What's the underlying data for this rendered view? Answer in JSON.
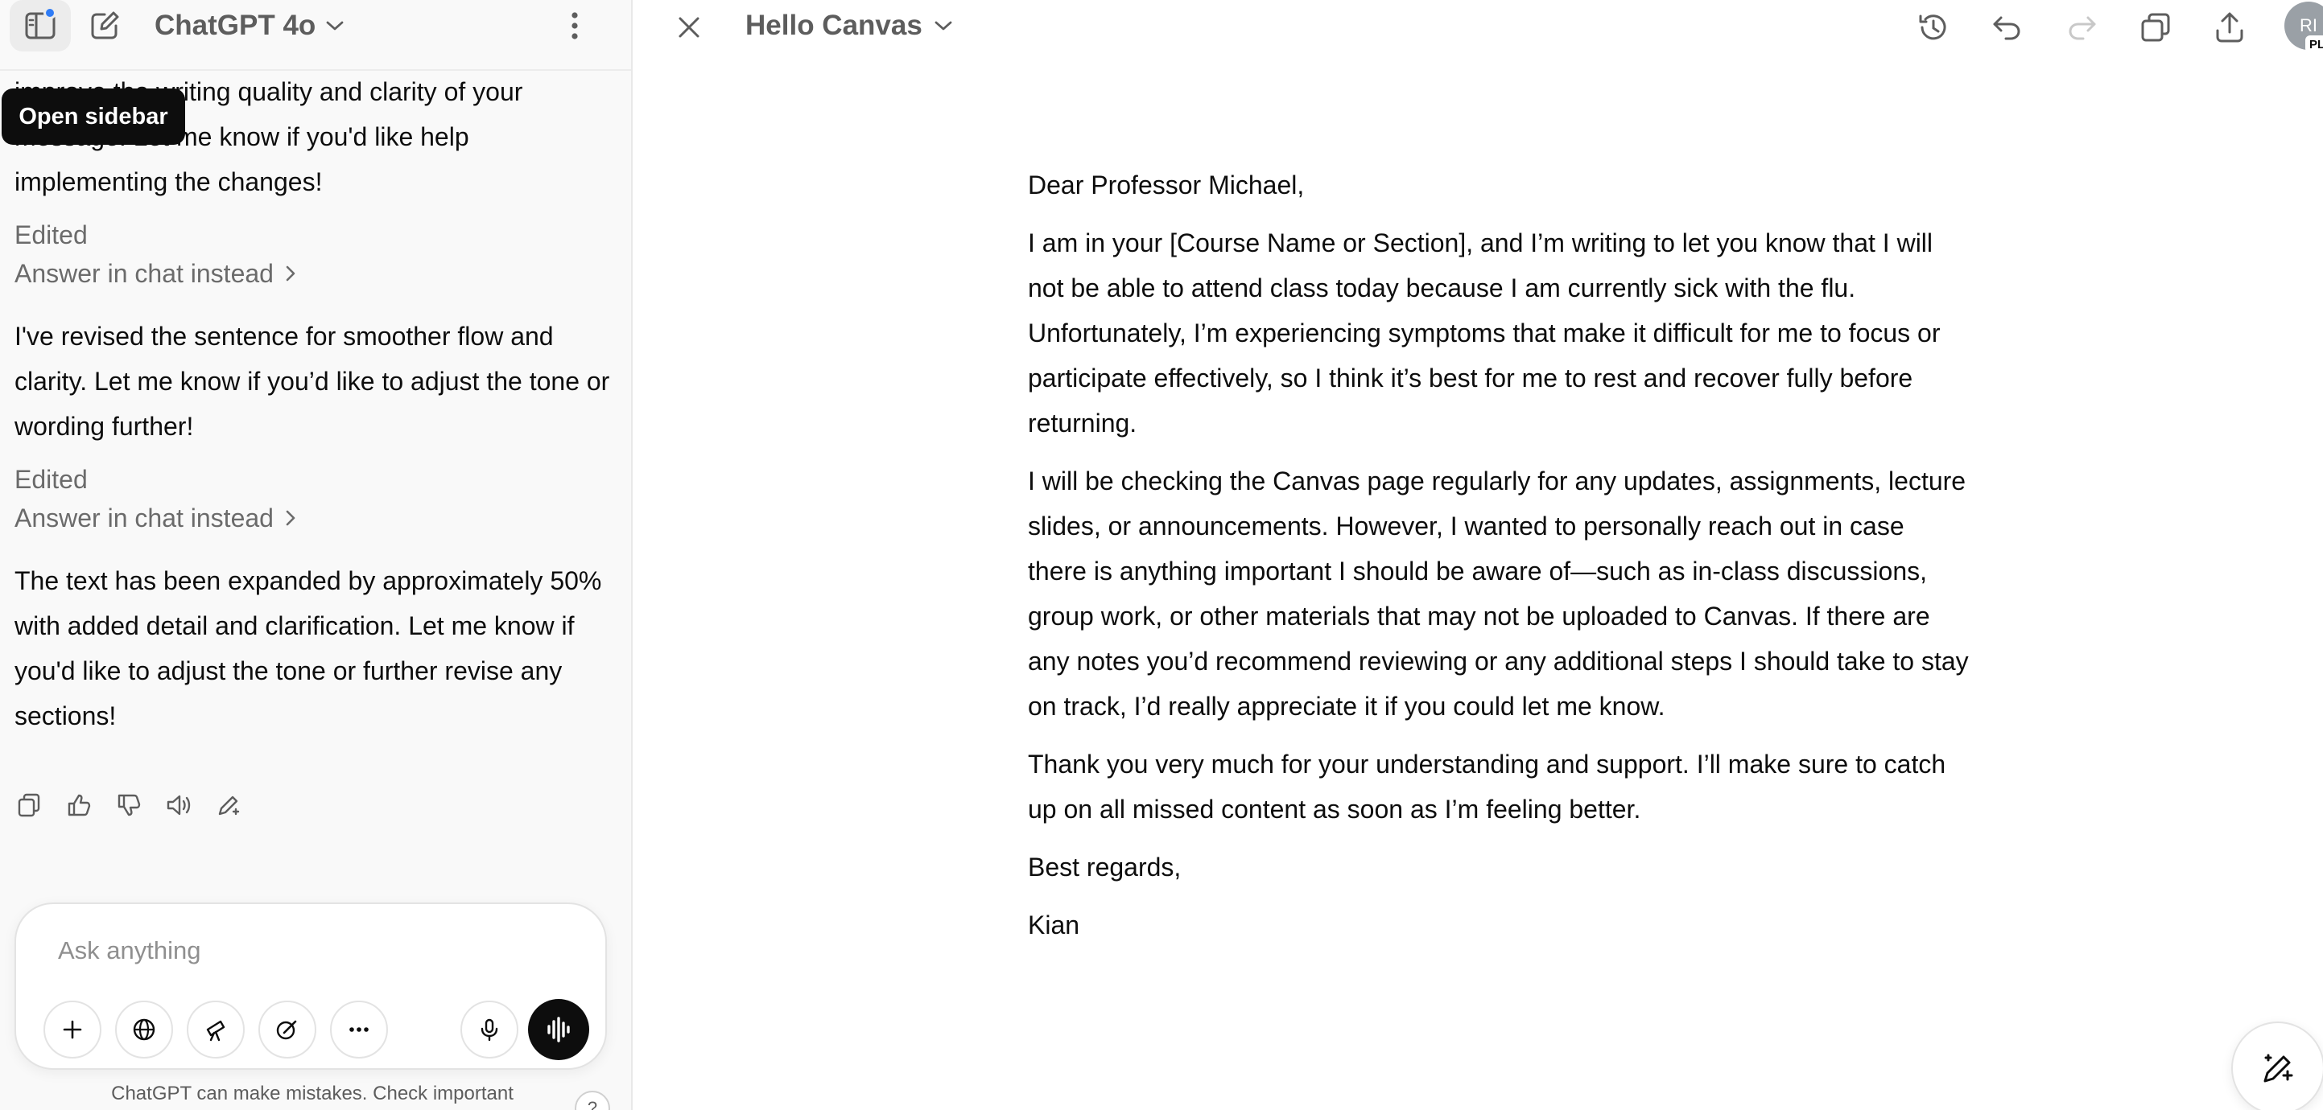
{
  "chat_header": {
    "model_name": "ChatGPT 4o",
    "tooltip": "Open sidebar"
  },
  "chat": {
    "partial_message": "I've added comments and suggestions to help improve the writing quality and clarity of your message. Let me know if you'd like help implementing the changes!",
    "partial_line1": "improve the writing quality and clarity of your",
    "partial_line2": "message. Let me know if you'd like help",
    "partial_line3": "implementing the changes!",
    "edited_label": "Edited",
    "answer_link": "Answer in chat instead",
    "message2": "I've revised the sentence for smoother flow and clarity. Let me know if you’d like to adjust the tone or wording further!",
    "message3": "The text has been expanded by approximately 50% with added detail and clarification. Let me know if you'd like to adjust the tone or further revise any sections!"
  },
  "composer": {
    "placeholder": "Ask anything",
    "disclaimer": "ChatGPT can make mistakes. Check important",
    "help": "?"
  },
  "canvas": {
    "title": "Hello Canvas",
    "avatar_initials": "RI",
    "plan_badge": "PLU",
    "paragraphs": [
      "Dear Professor Michael,",
      "I am in your [Course Name or Section], and I’m writing to let you know that I will not be able to attend class today because I am currently sick with the flu. Unfortunately, I’m experiencing symptoms that make it difficult for me to focus or participate effectively, so I think it’s best for me to rest and recover fully before returning.",
      "I will be checking the Canvas page regularly for any updates, assignments, lecture slides, or announcements. However, I wanted to personally reach out in case there is anything important I should be aware of—such as in-class discussions, group work, or other materials that may not be uploaded to Canvas. If there are any notes you’d recommend reviewing or any additional steps I should take to stay on track, I’d really appreciate it if you could let me know.",
      "Thank you very much for your understanding and support. I’ll make sure to catch up on all missed content as soon as I’m feeling better.",
      "Best regards,",
      "Kian"
    ]
  },
  "colors": {
    "sidebar_bg": "#f9f9f9",
    "notification_dot": "#2f7cf6",
    "text_primary": "#0d0d0d",
    "text_muted": "#6b6b6b"
  },
  "icons": [
    "sidebar-toggle-icon",
    "new-chat-icon",
    "chevron-down-icon",
    "more-vertical-icon",
    "close-icon",
    "history-icon",
    "undo-icon",
    "redo-icon",
    "copy-icon",
    "share-icon",
    "thumbs-up-icon",
    "thumbs-down-icon",
    "speaker-icon",
    "edit-sparkle-icon",
    "plus-icon",
    "globe-icon",
    "telescope-icon",
    "image-brush-icon",
    "ellipsis-icon",
    "microphone-icon",
    "voice-wave-icon",
    "pencil-sparkle-icon"
  ]
}
